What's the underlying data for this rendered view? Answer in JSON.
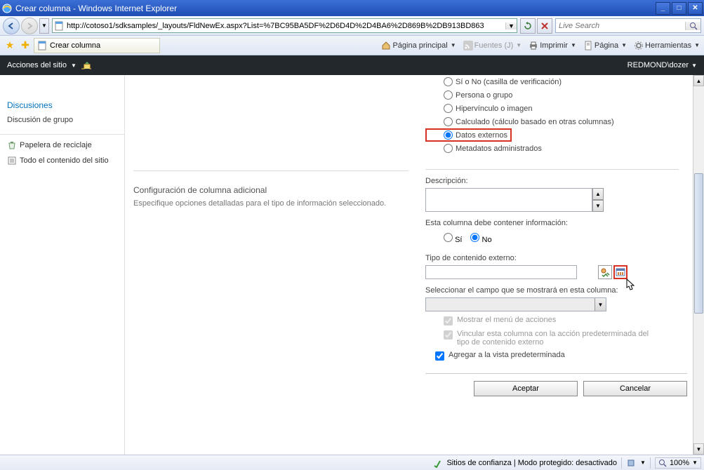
{
  "window": {
    "title": "Crear columna - Windows Internet Explorer"
  },
  "nav": {
    "url": "http://cotoso1/sdksamples/_layouts/FldNewEx.aspx?List=%7BC95BA5DF%2D6D4D%2D4BA6%2D869B%2DB913BD863",
    "search_placeholder": "Live Search"
  },
  "favbar": {
    "tab_title": "Crear columna",
    "tools": {
      "home": "Página principal",
      "feeds": "Fuentes (J)",
      "print": "Imprimir",
      "page": "Página",
      "tools_label": "Herramientas"
    }
  },
  "ribbon": {
    "site_actions": "Acciones del sitio",
    "user": "REDMOND\\dozer"
  },
  "sidebar": {
    "discusiones": "Discusiones",
    "discusion_grupo": "Discusión de grupo",
    "papelera": "Papelera de reciclaje",
    "todo_contenido": "Todo el contenido del sitio"
  },
  "section": {
    "title": "Configuración de columna adicional",
    "desc": "Especifique opciones detalladas para el tipo de información seleccionado."
  },
  "radios": {
    "si_no": "Sí o No (casilla de verificación)",
    "persona": "Persona o grupo",
    "hipervinculo": "Hipervínculo o imagen",
    "calculado": "Calculado (cálculo basado en otras columnas)",
    "datos_externos": "Datos externos",
    "metadatos": "Metadatos administrados"
  },
  "form": {
    "descripcion": "Descripción:",
    "contener_info": "Esta columna debe contener información:",
    "si": "Sí",
    "no": "No",
    "tipo_contenido": "Tipo de contenido externo:",
    "seleccionar_campo": "Seleccionar el campo que se mostrará en esta columna:",
    "mostrar_menu": "Mostrar el menú de acciones",
    "vincular": "Vincular esta columna con la acción predeterminada del tipo de contenido externo",
    "agregar_vista": "Agregar a la vista predeterminada"
  },
  "buttons": {
    "aceptar": "Aceptar",
    "cancelar": "Cancelar"
  },
  "status": {
    "sitios": "Sitios de confianza | Modo protegido: desactivado",
    "zoom": "100%"
  }
}
